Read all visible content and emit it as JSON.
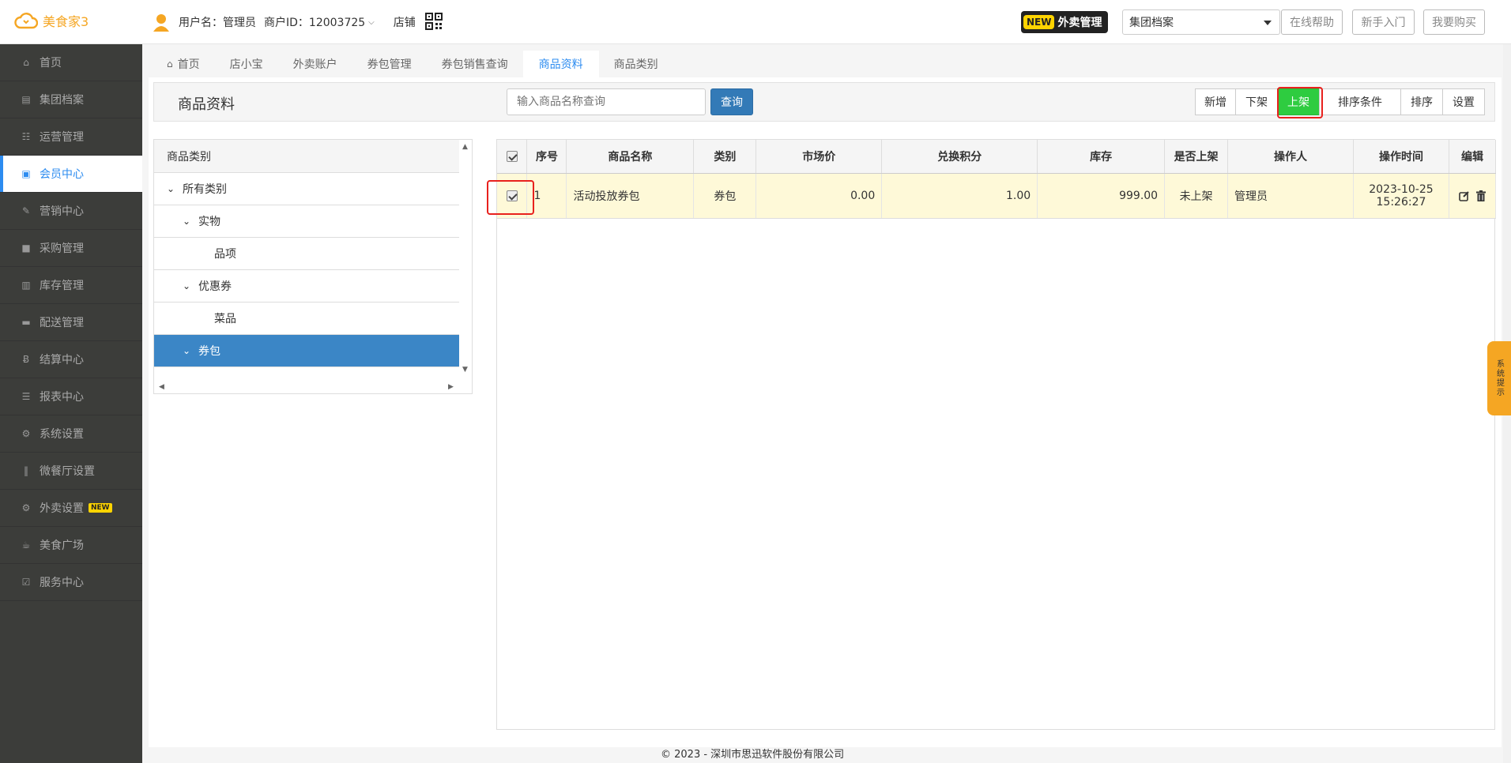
{
  "app": {
    "logo_text": "美食家3"
  },
  "header": {
    "username_label": "用户名：管理员",
    "merchant_label": "商户ID：12003725",
    "store_link": "店铺",
    "new_badge": "NEW",
    "new_label": "外卖管理",
    "group_select_value": "集团档案",
    "help_button": "在线帮助",
    "guide_button": "新手入门",
    "buy_button": "我要购买"
  },
  "sidebar": {
    "items": [
      {
        "label": "首页",
        "icon": "home-icon"
      },
      {
        "label": "集团档案",
        "icon": "file-icon"
      },
      {
        "label": "运营管理",
        "icon": "bar-chart-icon"
      },
      {
        "label": "会员中心",
        "icon": "id-card-icon"
      },
      {
        "label": "营销中心",
        "icon": "edit-icon"
      },
      {
        "label": "采购管理",
        "icon": "book-icon"
      },
      {
        "label": "库存管理",
        "icon": "building-icon"
      },
      {
        "label": "配送管理",
        "icon": "truck-icon"
      },
      {
        "label": "结算中心",
        "icon": "bitcoin-icon"
      },
      {
        "label": "报表中心",
        "icon": "document-icon"
      },
      {
        "label": "系统设置",
        "icon": "cogs-icon"
      },
      {
        "label": "微餐厅设置",
        "icon": "cutlery-icon"
      },
      {
        "label": "外卖设置",
        "icon": "gear-icon",
        "tag": "NEW"
      },
      {
        "label": "美食广场",
        "icon": "coffee-icon"
      },
      {
        "label": "服务中心",
        "icon": "check-square-icon"
      }
    ]
  },
  "tabs": [
    {
      "label": "首页"
    },
    {
      "label": "店小宝"
    },
    {
      "label": "外卖账户"
    },
    {
      "label": "券包管理"
    },
    {
      "label": "券包销售查询"
    },
    {
      "label": "商品资料"
    },
    {
      "label": "商品类别"
    }
  ],
  "toolbar": {
    "title": "商品资料",
    "search_placeholder": "输入商品名称查询",
    "query_button": "查询",
    "buttons": [
      "新增",
      "下架",
      "上架",
      "排序条件",
      "排序",
      "设置"
    ]
  },
  "tree": {
    "header": "商品类别",
    "nodes": [
      {
        "label": "所有类别",
        "expanded": true
      },
      {
        "label": "实物",
        "expanded": true
      },
      {
        "label": "品项"
      },
      {
        "label": "优惠券",
        "expanded": true
      },
      {
        "label": "菜品"
      },
      {
        "label": "券包",
        "expanded": true,
        "selected": true
      }
    ]
  },
  "table": {
    "columns": [
      "序号",
      "商品名称",
      "类别",
      "市场价",
      "兑换积分",
      "库存",
      "是否上架",
      "操作人",
      "操作时间",
      "编辑"
    ],
    "rows": [
      {
        "checked": true,
        "index": "1",
        "name": "活动投放券包",
        "category": "券包",
        "market_price": "0.00",
        "points": "1.00",
        "stock": "999.00",
        "on_shelf": "未上架",
        "operator": "管理员",
        "time_date": "2023-10-25",
        "time_clock": "15:26:27"
      }
    ]
  },
  "side_tip": "系统提示",
  "footer": "© 2023 - 深圳市思迅软件股份有限公司"
}
